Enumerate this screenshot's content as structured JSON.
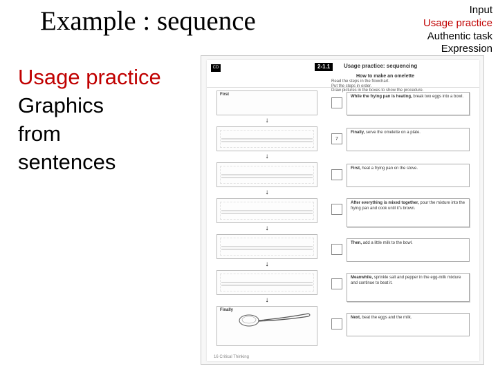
{
  "title": "Example : sequence",
  "nav": {
    "items": [
      "Input",
      "Usage practice",
      "Authentic task",
      "Expression"
    ],
    "active_index": 1
  },
  "sidetext": {
    "highlight": "Usage practice",
    "lines": [
      "Graphics",
      "from",
      "sentences"
    ]
  },
  "worksheet": {
    "cd_label": "CD",
    "unit_badge": "2-1.1",
    "unit_title": "Usage practice: sequencing",
    "task_title": "How to make an omelette",
    "instruction1": "Read the steps in the flowchart.",
    "instruction2": "Put the steps in order.",
    "instruction3": "Draw pictures in the boxes to show the procedure.",
    "first_label": "First",
    "finally_label": "Finally",
    "steps": [
      {
        "num": "",
        "bold": "While the frying pan is heating,",
        "rest": " break two eggs into a bowl."
      },
      {
        "num": "7",
        "bold": "Finally,",
        "rest": " serve the omelette on a plate."
      },
      {
        "num": "",
        "bold": "First,",
        "rest": " heat a frying pan on the stove."
      },
      {
        "num": "",
        "bold": "After everything is mixed together,",
        "rest": " pour the mixture into the frying pan and cook until it's brown."
      },
      {
        "num": "",
        "bold": "Then,",
        "rest": " add a little milk to the bowl."
      },
      {
        "num": "",
        "bold": "Meanwhile,",
        "rest": " sprinkle salt and pepper in the egg-milk mixture and continue to beat it."
      },
      {
        "num": "",
        "bold": "Next,",
        "rest": " beat the eggs and the milk."
      }
    ],
    "footer": "16  Critical Thinking"
  }
}
